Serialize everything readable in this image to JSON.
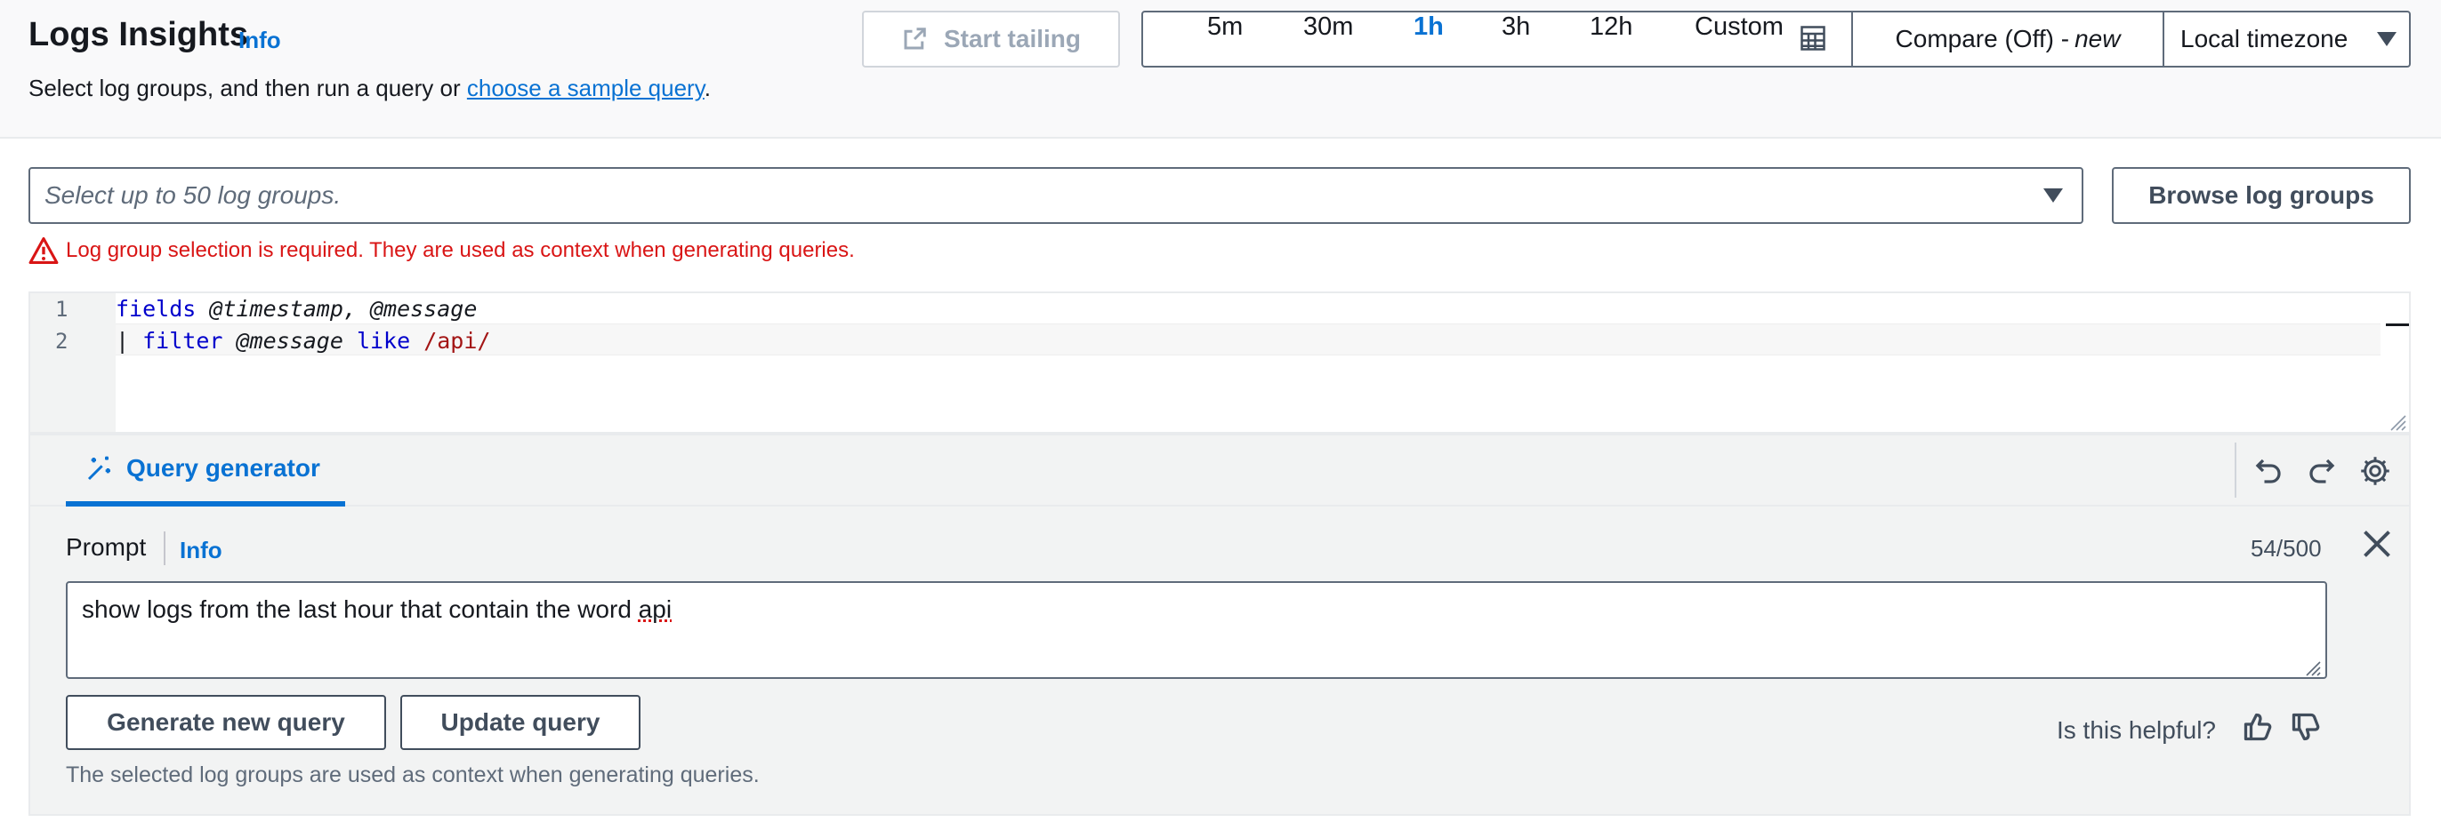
{
  "header": {
    "title": "Logs Insights",
    "info": "Info",
    "description_prefix": "Select log groups, and then run a query or ",
    "description_link": "choose a sample query",
    "description_suffix": "."
  },
  "toolbar": {
    "start_tailing": "Start tailing",
    "time_ranges": [
      "5m",
      "30m",
      "1h",
      "3h",
      "12h"
    ],
    "selected_range": "1h",
    "custom": "Custom",
    "compare": "Compare (Off) - ",
    "compare_new": "new",
    "timezone": "Local timezone"
  },
  "log_groups": {
    "placeholder": "Select up to 50 log groups.",
    "browse": "Browse log groups",
    "error": "Log group selection is required. They are used as context when generating queries."
  },
  "editor": {
    "line_numbers": [
      "1",
      "2"
    ],
    "line1": {
      "kw": "fields",
      "rest": " @timestamp, @message"
    },
    "line2": {
      "pipe": "| ",
      "kw1": "filter",
      "mid": " @message ",
      "kw2": "like",
      "re": " /api/"
    }
  },
  "query_generator": {
    "tab": "Query generator",
    "prompt_label": "Prompt",
    "info": "Info",
    "counter": "54/500",
    "prompt_text_prefix": "show logs from the last hour that contain the word ",
    "prompt_text_misspelled": "api",
    "generate": "Generate new query",
    "update": "Update query",
    "helpful": "Is this helpful?",
    "footnote": "The selected log groups are used as context when generating queries."
  },
  "colors": {
    "accent": "#0972d3",
    "error": "#d91515",
    "border": "#5f6b7a"
  }
}
